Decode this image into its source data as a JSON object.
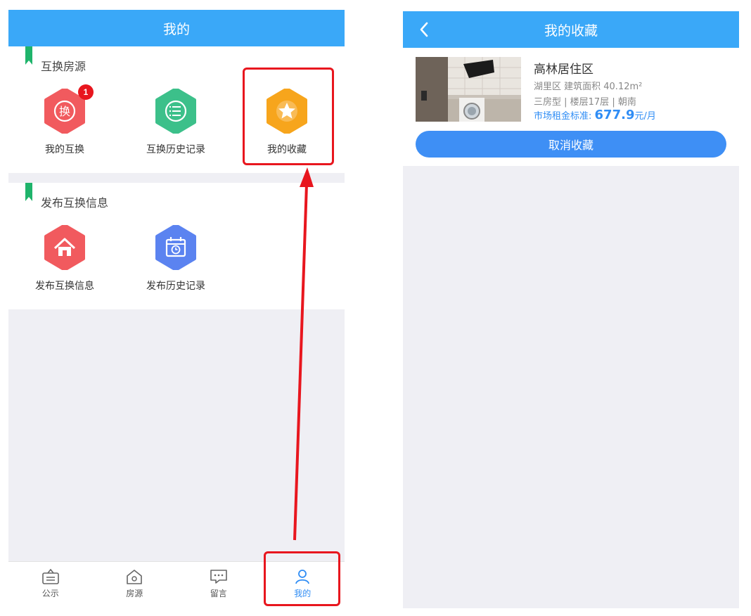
{
  "left": {
    "header_title": "我的",
    "exchange_section": {
      "title": "互换房源",
      "items": [
        {
          "label": "我的互换",
          "badge": "1",
          "icon": "exchange-icon",
          "color": "#f15a5e"
        },
        {
          "label": "互换历史记录",
          "icon": "list-icon",
          "color": "#3cc08a"
        },
        {
          "label": "我的收藏",
          "icon": "star-icon",
          "color": "#f7a51c"
        }
      ]
    },
    "publish_section": {
      "title": "发布互换信息",
      "items": [
        {
          "label": "发布互换信息",
          "icon": "house-icon",
          "color": "#f15a5e"
        },
        {
          "label": "发布历史记录",
          "icon": "calendar-icon",
          "color": "#5b83f0"
        }
      ]
    },
    "tabbar": [
      {
        "label": "公示",
        "icon": "notice-icon"
      },
      {
        "label": "房源",
        "icon": "home-outline-icon"
      },
      {
        "label": "留言",
        "icon": "message-icon"
      },
      {
        "label": "我的",
        "icon": "user-icon",
        "active": true
      }
    ]
  },
  "right": {
    "header_title": "我的收藏",
    "favorite": {
      "name": "高林居住区",
      "line1": "湖里区  建筑面积 40.12m²",
      "line2": "三房型 | 楼层17层 | 朝南",
      "price_label": "市场租金标准:",
      "price_value": "677.9",
      "price_unit": "元/月",
      "unfavorite_button": "取消收藏"
    }
  },
  "colors": {
    "header": "#3aa8f8",
    "accent": "#2f8df5",
    "bookmark": "#1fb46b",
    "highlight": "#e8161e"
  }
}
